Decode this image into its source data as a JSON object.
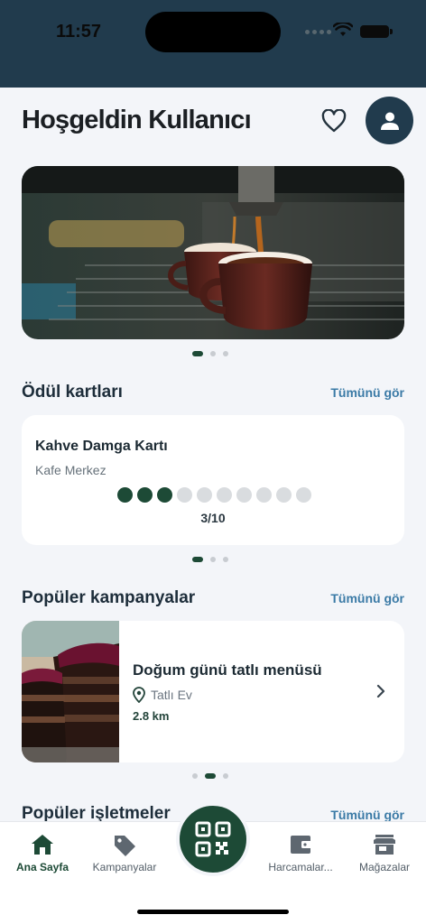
{
  "status": {
    "time": "11:57"
  },
  "header": {
    "greeting": "Hoşgeldin Kullanıcı"
  },
  "rewards": {
    "title": "Ödül kartları",
    "see_all": "Tümünü gör",
    "card": {
      "title": "Kahve Damga Kartı",
      "business": "Kafe Merkez",
      "count_label": "3/10",
      "stamps_filled": 3,
      "stamps_total": 10
    }
  },
  "campaigns": {
    "title": "Popüler kampanyalar",
    "see_all": "Tümünü gör",
    "card": {
      "title": "Doğum günü tatlı menüsü",
      "location": "Tatlı Ev",
      "distance": "2.8 km"
    }
  },
  "businesses": {
    "title": "Popüler işletmeler",
    "see_all": "Tümünü gör"
  },
  "nav": {
    "items": [
      {
        "label": "Ana Sayfa",
        "icon": "home-icon",
        "active": true
      },
      {
        "label": "Kampanyalar",
        "icon": "tag-icon",
        "active": false
      },
      {
        "label": "Harcamalar...",
        "icon": "wallet-icon",
        "active": false
      },
      {
        "label": "Mağazalar",
        "icon": "store-icon",
        "active": false
      }
    ],
    "center": {
      "icon": "qr-code-icon"
    }
  },
  "colors": {
    "primary": "#1d4a36",
    "header": "#213b4d",
    "link": "#3a7aa6"
  }
}
